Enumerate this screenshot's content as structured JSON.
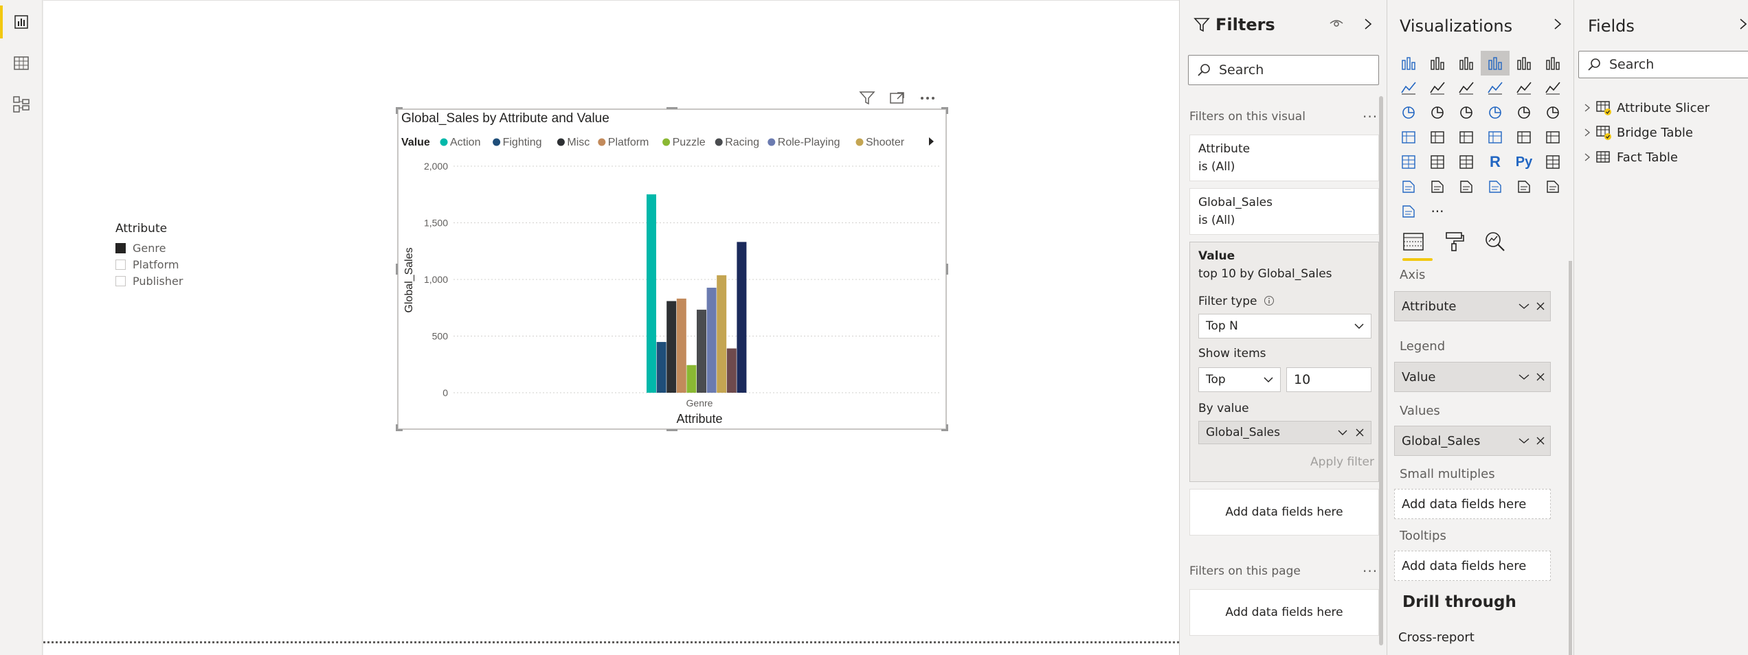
{
  "canvas": {
    "slicer": {
      "title": "Attribute",
      "items": [
        {
          "label": "Genre",
          "checked": true
        },
        {
          "label": "Platform",
          "checked": false
        },
        {
          "label": "Publisher",
          "checked": false
        }
      ]
    }
  },
  "chart_data": {
    "type": "bar",
    "title": "Global_Sales by Attribute and Value",
    "xlabel": "Attribute",
    "ylabel": "Global_Sales",
    "legend_title": "Value",
    "legend_placement": "top",
    "categories": [
      "Genre"
    ],
    "ylim": [
      0,
      2000
    ],
    "yticks": [
      "0",
      "500",
      "1,000",
      "1,500",
      "2,000"
    ],
    "ytick_values": [
      0,
      500,
      1000,
      1500,
      2000
    ],
    "grid": true,
    "series": [
      {
        "name": "Action",
        "color": "#01B8AA",
        "values": [
          1751
        ]
      },
      {
        "name": "Fighting",
        "color": "#1F4E79",
        "values": [
          448
        ]
      },
      {
        "name": "Misc",
        "color": "#2D3033",
        "values": [
          809
        ]
      },
      {
        "name": "Platform",
        "color": "#C28A5B",
        "values": [
          831
        ]
      },
      {
        "name": "Puzzle",
        "color": "#8AB833",
        "values": [
          244
        ]
      },
      {
        "name": "Racing",
        "color": "#4A4C4F",
        "values": [
          733
        ]
      },
      {
        "name": "Role-Playing",
        "color": "#6B7BB0",
        "values": [
          927
        ]
      },
      {
        "name": "Shooter",
        "color": "#C4A552",
        "values": [
          1037
        ]
      },
      {
        "name": "",
        "color": "#6E4A4D",
        "values": [
          391
        ]
      },
      {
        "name": "",
        "color": "#1B2A5B",
        "values": [
          1331
        ]
      }
    ]
  },
  "filters": {
    "title": "Filters",
    "search_placeholder": "Search",
    "on_visual_label": "Filters on this visual",
    "cards": [
      {
        "name": "Attribute",
        "state": "is (All)"
      },
      {
        "name": "Global_Sales",
        "state": "is (All)"
      }
    ],
    "value_card": {
      "title": "Value",
      "subtitle": "top 10 by Global_Sales",
      "filter_type_label": "Filter type",
      "filter_type": "Top N",
      "show_items_label": "Show items",
      "show_items_direction": "Top",
      "show_items_count": "10",
      "by_value_label": "By value",
      "by_value": "Global_Sales",
      "apply": "Apply filter"
    },
    "add_fields": "Add data fields here",
    "on_page_label": "Filters on this page",
    "add_fields_page": "Add data fields here"
  },
  "visualizations": {
    "title": "Visualizations",
    "wells": {
      "axis_label": "Axis",
      "axis_value": "Attribute",
      "legend_label": "Legend",
      "legend_value": "Value",
      "values_label": "Values",
      "values_value": "Global_Sales",
      "small_multiples_label": "Small multiples",
      "small_multiples_placeholder": "Add data fields here",
      "tooltips_label": "Tooltips",
      "tooltips_placeholder": "Add data fields here"
    },
    "drill_through": "Drill through",
    "cross_report": "Cross-report",
    "r_label": "R",
    "py_label": "Py",
    "more": "···"
  },
  "fields": {
    "title": "Fields",
    "search_placeholder": "Search",
    "tables": [
      "Attribute Slicer",
      "Bridge Table",
      "Fact Table"
    ]
  },
  "colors": {
    "accent": "#F2C811"
  }
}
